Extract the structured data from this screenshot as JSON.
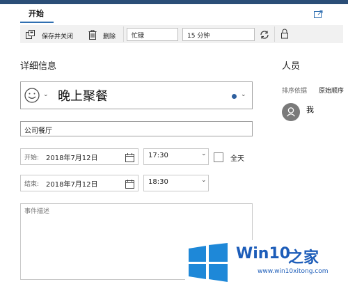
{
  "tabs": {
    "start": "开始"
  },
  "toolbar": {
    "save_close": "保存并关闭",
    "delete": "删除",
    "show_as": "忙碌",
    "reminder": "15 分钟"
  },
  "details": {
    "heading": "详细信息",
    "title": "晚上聚餐",
    "location": "公司餐厅",
    "start_label": "开始:",
    "start_date": "2018年7月12日",
    "start_time": "17:30",
    "all_day": "全天",
    "end_label": "结束:",
    "end_date": "2018年7月12日",
    "end_time": "18:30",
    "description_placeholder": "事件描述"
  },
  "people": {
    "heading": "人员",
    "sort_label": "排序依据",
    "sort_value": "原始顺序",
    "me": "我"
  },
  "watermark": {
    "brand": "Win10",
    "brand_suffix": "之家",
    "url": "www.win10xitong.com"
  },
  "colors": {
    "accent": "#2f6fb1",
    "titlebar": "#2b4e77",
    "calendar_dot": "#2e5f9e",
    "watermark_blue": "#1d5db9"
  }
}
